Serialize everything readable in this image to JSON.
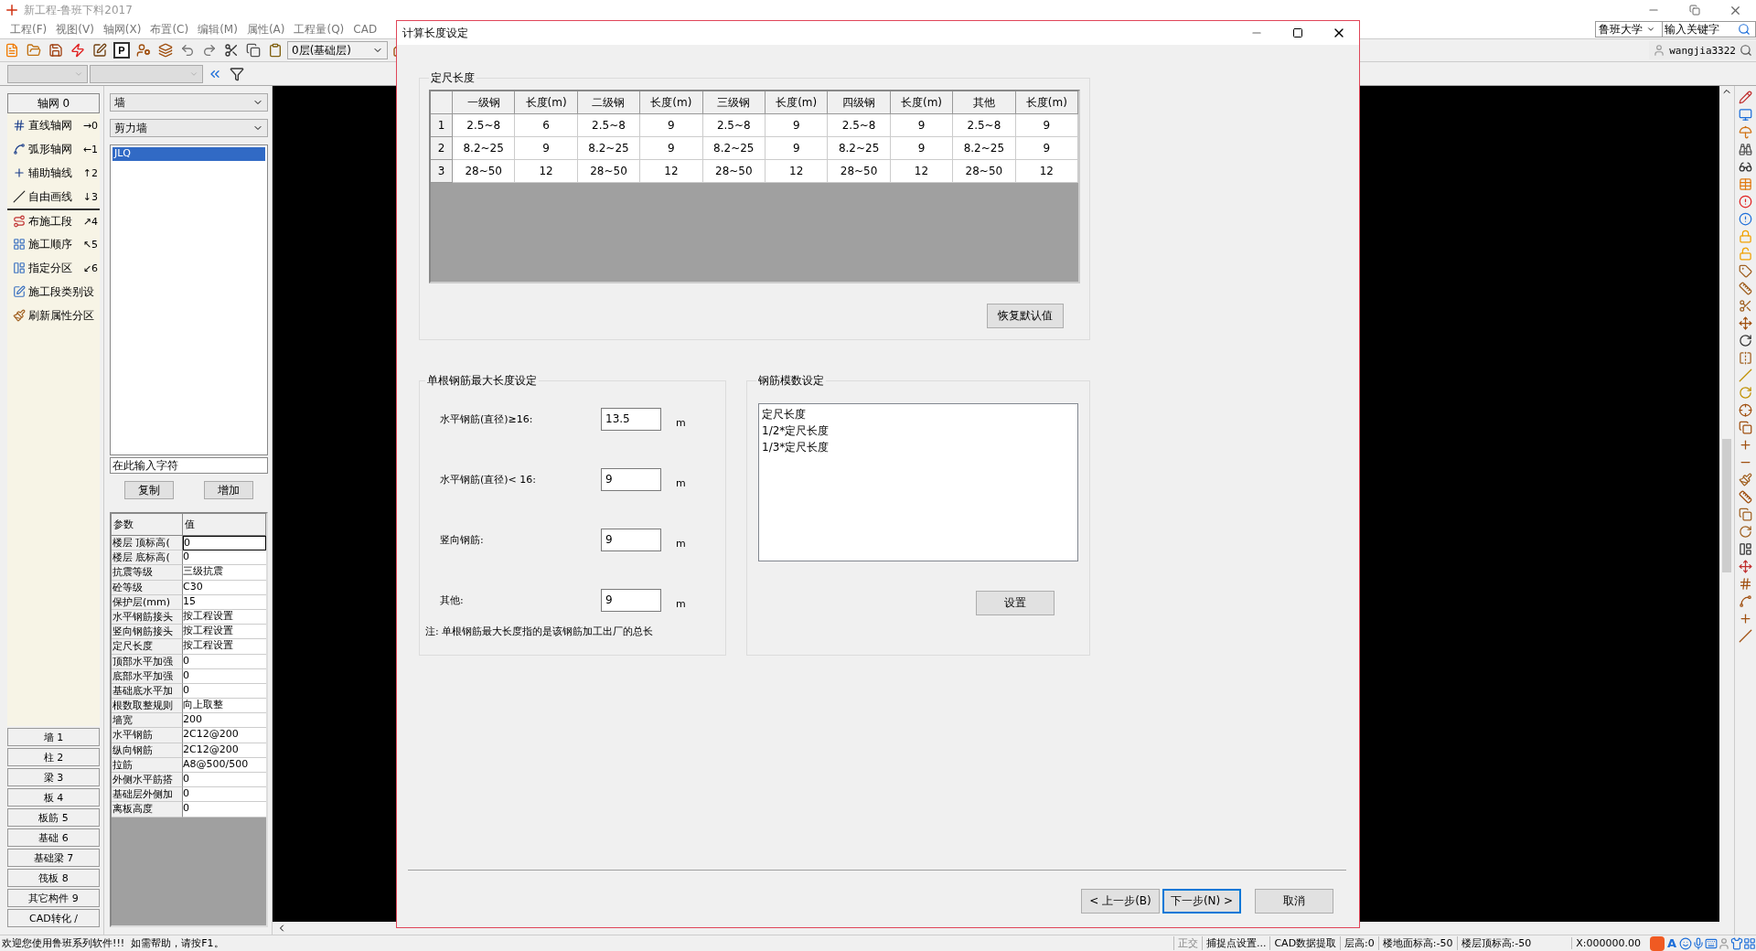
{
  "app": {
    "title": "新工程-鲁班下料2017"
  },
  "menu": [
    "工程(F)",
    "视图(V)",
    "轴网(X)",
    "布置(C)",
    "编辑(M)",
    "属性(A)",
    "工程量(Q)",
    "CAD"
  ],
  "university_select": "鲁班大学",
  "search": {
    "placeholder": "输入关键字"
  },
  "user": "wangjia3322",
  "toolbar": {
    "p_label": "P",
    "floor_select": "0层(基础层)"
  },
  "axis_panel": {
    "header": "轴网 0",
    "items": [
      {
        "label": "直线轴网",
        "shortcut": "→0"
      },
      {
        "label": "弧形轴网",
        "shortcut": "←1"
      },
      {
        "label": "辅助轴线",
        "shortcut": "↑2"
      },
      {
        "label": "自由画线",
        "shortcut": "↓3"
      },
      {
        "label": "布施工段",
        "shortcut": "↗4"
      },
      {
        "label": "施工顺序",
        "shortcut": "↖5"
      },
      {
        "label": "指定分区",
        "shortcut": "↙6"
      },
      {
        "label": "施工段类别设"
      },
      {
        "label": "刷新属性分区"
      }
    ]
  },
  "categories": [
    "墙 1",
    "柱 2",
    "梁 3",
    "板 4",
    "板筋 5",
    "基础 6",
    "基础梁 7",
    "筏板 8",
    "其它构件 9",
    "CAD转化 /"
  ],
  "component": {
    "type_select": "墙",
    "subtype_select": "剪力墙",
    "list": [
      {
        "label": "JLQ",
        "selected": true
      }
    ],
    "name_input": "在此输入字符",
    "buttons": [
      "复制",
      "增加"
    ]
  },
  "properties": {
    "columns": [
      "参数",
      "值"
    ],
    "rows": [
      {
        "name": "楼层 顶标高(",
        "value": "0",
        "focused": true
      },
      {
        "name": "楼层 底标高(",
        "value": "0",
        "focused": false
      },
      {
        "name": "抗震等级",
        "value": "三级抗震",
        "focused": false
      },
      {
        "name": "砼等级",
        "value": "C30",
        "focused": false
      },
      {
        "name": "保护层(mm)",
        "value": "15",
        "focused": false
      },
      {
        "name": "水平钢筋接头",
        "value": "按工程设置",
        "focused": false
      },
      {
        "name": "竖向钢筋接头",
        "value": "按工程设置",
        "focused": false
      },
      {
        "name": "定尺长度",
        "value": "按工程设置",
        "focused": false
      },
      {
        "name": "顶部水平加强",
        "value": "0",
        "focused": false
      },
      {
        "name": "底部水平加强",
        "value": "0",
        "focused": false
      },
      {
        "name": "基础底水平加",
        "value": "0",
        "focused": false
      },
      {
        "name": "根数取整规则",
        "value": "向上取整",
        "focused": false
      },
      {
        "name": "墙宽",
        "value": "200",
        "focused": false
      },
      {
        "name": "水平钢筋",
        "value": "2C12@200",
        "focused": false
      },
      {
        "name": "纵向钢筋",
        "value": "2C12@200",
        "focused": false
      },
      {
        "name": "拉筋",
        "value": "A8@500/500",
        "focused": false
      },
      {
        "name": "外侧水平筋搭",
        "value": "0",
        "focused": false
      },
      {
        "name": "基础层外侧加",
        "value": "0",
        "focused": false
      },
      {
        "name": "离板高度",
        "value": "0",
        "focused": false
      }
    ]
  },
  "dialog": {
    "title": "计算长度设定",
    "fixed_length": {
      "title": "定尺长度",
      "columns": [
        "一级钢",
        "长度(m)",
        "二级钢",
        "长度(m)",
        "三级钢",
        "长度(m)",
        "四级钢",
        "长度(m)",
        "其他",
        "长度(m)"
      ],
      "rows": [
        {
          "index": "1",
          "cells": [
            "2.5~8",
            "6",
            "2.5~8",
            "9",
            "2.5~8",
            "9",
            "2.5~8",
            "9",
            "2.5~8",
            "9"
          ]
        },
        {
          "index": "2",
          "cells": [
            "8.2~25",
            "9",
            "8.2~25",
            "9",
            "8.2~25",
            "9",
            "8.2~25",
            "9",
            "8.2~25",
            "9"
          ]
        },
        {
          "index": "3",
          "cells": [
            "28~50",
            "12",
            "28~50",
            "12",
            "28~50",
            "12",
            "28~50",
            "12",
            "28~50",
            "12"
          ]
        }
      ],
      "reset_button": "恢复默认值"
    },
    "max_length": {
      "title": "单根钢筋最大长度设定",
      "fields": [
        {
          "label": "水平钢筋(直径)≥16:",
          "value": "13.5",
          "unit": "m"
        },
        {
          "label": "水平钢筋(直径)< 16:",
          "value": "9",
          "unit": "m"
        },
        {
          "label": "竖向钢筋:",
          "value": "9",
          "unit": "m"
        },
        {
          "label": "其他:",
          "value": "9",
          "unit": "m"
        }
      ],
      "note": "注: 单根钢筋最大长度指的是该钢筋加工出厂的总长"
    },
    "modulus": {
      "title": "钢筋模数设定",
      "items": [
        "定尺长度",
        "1/2*定尺长度",
        "1/3*定尺长度"
      ],
      "button": "设置"
    },
    "buttons": [
      {
        "label": "< 上一步(B)",
        "default": false
      },
      {
        "label": "下一步(N) >",
        "default": true
      },
      {
        "label": "取消",
        "default": false
      }
    ]
  },
  "status_bar": {
    "message": "欢迎您使用鲁班系列软件!!!  如需帮助，请按F1。",
    "cells": [
      "正交",
      "捕捉点设置...",
      "CAD数据提取",
      "层高:0",
      "楼地面标高:-50",
      "楼层顶标高:-50"
    ],
    "coords": "X:000000.00",
    "ime": "A"
  }
}
